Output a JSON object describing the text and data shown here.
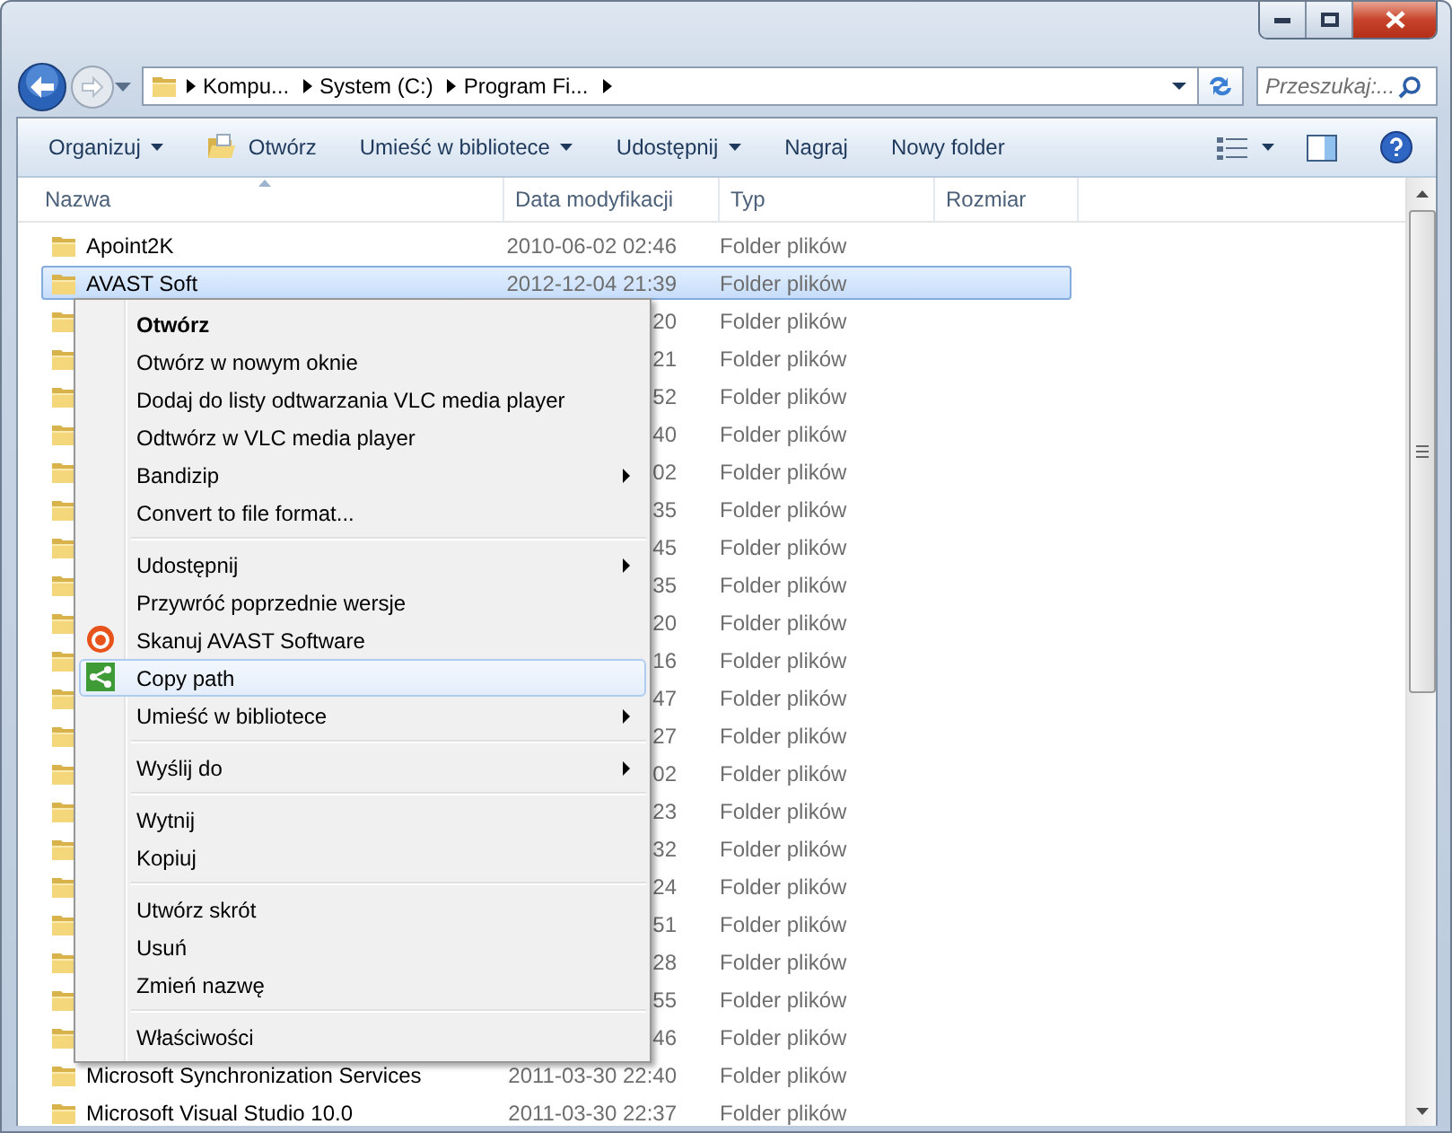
{
  "address": {
    "breadcrumbs": [
      "Kompu...",
      "System (C:)",
      "Program Fi..."
    ]
  },
  "search": {
    "placeholder": "Przeszukaj:..."
  },
  "toolbar": [
    {
      "kind": "plain",
      "label": "Organizuj",
      "dropdown": true
    },
    {
      "kind": "open",
      "label": "Otwórz",
      "dropdown": false
    },
    {
      "kind": "plain",
      "label": "Umieść w bibliotece",
      "dropdown": true
    },
    {
      "kind": "plain",
      "label": "Udostępnij",
      "dropdown": true
    },
    {
      "kind": "plain",
      "label": "Nagraj",
      "dropdown": false
    },
    {
      "kind": "plain",
      "label": "Nowy folder",
      "dropdown": false
    }
  ],
  "columns": [
    "Nazwa",
    "Data modyfikacji",
    "Typ",
    "Rozmiar"
  ],
  "rows": [
    {
      "name": "Apoint2K",
      "date": "2010-06-02 02:46",
      "type": "Folder plików",
      "selected": false
    },
    {
      "name": "AVAST Soft",
      "date": "2012-12-04 21:39",
      "type": "Folder plików",
      "selected": true
    },
    {
      "date": "20",
      "type": "Folder plików",
      "selected": false
    },
    {
      "date": "21",
      "type": "Folder plików",
      "selected": false
    },
    {
      "date": "52",
      "type": "Folder plików",
      "selected": false
    },
    {
      "date": "40",
      "type": "Folder plików",
      "selected": false
    },
    {
      "date": "02",
      "type": "Folder plików",
      "selected": false
    },
    {
      "date": "35",
      "type": "Folder plików",
      "selected": false
    },
    {
      "date": "45",
      "type": "Folder plików",
      "selected": false
    },
    {
      "date": "35",
      "type": "Folder plików",
      "selected": false
    },
    {
      "date": "20",
      "type": "Folder plików",
      "selected": false
    },
    {
      "date": "16",
      "type": "Folder plików",
      "selected": false
    },
    {
      "date": "47",
      "type": "Folder plików",
      "selected": false
    },
    {
      "date": "27",
      "type": "Folder plików",
      "selected": false
    },
    {
      "date": "02",
      "type": "Folder plików",
      "selected": false
    },
    {
      "date": "23",
      "type": "Folder plików",
      "selected": false
    },
    {
      "date": "32",
      "type": "Folder plików",
      "selected": false
    },
    {
      "date": "24",
      "type": "Folder plików",
      "selected": false
    },
    {
      "date": "51",
      "type": "Folder plików",
      "selected": false
    },
    {
      "date": "28",
      "type": "Folder plików",
      "selected": false
    },
    {
      "date": "55",
      "type": "Folder plików",
      "selected": false
    },
    {
      "date": "46",
      "type": "Folder plików",
      "selected": false
    },
    {
      "name": "Microsoft Synchronization Services",
      "date": "2011-03-30 22:40",
      "type": "Folder plików",
      "selected": false
    },
    {
      "name": "Microsoft Visual Studio 10.0",
      "date": "2011-03-30 22:37",
      "type": "Folder plików",
      "selected": false
    }
  ],
  "context_menu": {
    "items": [
      {
        "kind": "item",
        "label": "Otwórz",
        "bold": true,
        "submenu": false,
        "selected": false
      },
      {
        "kind": "item",
        "label": "Otwórz w nowym oknie",
        "bold": false,
        "submenu": false,
        "selected": false
      },
      {
        "kind": "item",
        "label": "Dodaj do listy odtwarzania VLC media player",
        "bold": false,
        "submenu": false,
        "selected": false
      },
      {
        "kind": "item",
        "label": "Odtwórz w VLC media player",
        "bold": false,
        "submenu": false,
        "selected": false
      },
      {
        "kind": "item",
        "label": "Bandizip",
        "bold": false,
        "submenu": true,
        "selected": false
      },
      {
        "kind": "item",
        "label": "Convert to file format...",
        "bold": false,
        "submenu": false,
        "selected": false
      },
      {
        "kind": "separator"
      },
      {
        "kind": "item",
        "label": "Udostępnij",
        "bold": false,
        "submenu": true,
        "selected": false
      },
      {
        "kind": "item",
        "label": "Przywróć poprzednie wersje",
        "bold": false,
        "submenu": false,
        "selected": false
      },
      {
        "kind": "scan",
        "label": "Skanuj AVAST Software",
        "bold": false,
        "submenu": false,
        "selected": false
      },
      {
        "kind": "share",
        "label": "Copy path",
        "bold": false,
        "submenu": false,
        "selected": true
      },
      {
        "kind": "item",
        "label": "Umieść w bibliotece",
        "bold": false,
        "submenu": true,
        "selected": false
      },
      {
        "kind": "separator"
      },
      {
        "kind": "item",
        "label": "Wyślij do",
        "bold": false,
        "submenu": true,
        "selected": false
      },
      {
        "kind": "separator"
      },
      {
        "kind": "item",
        "label": "Wytnij",
        "bold": false,
        "submenu": false,
        "selected": false
      },
      {
        "kind": "item",
        "label": "Kopiuj",
        "bold": false,
        "submenu": false,
        "selected": false
      },
      {
        "kind": "separator"
      },
      {
        "kind": "item",
        "label": "Utwórz skrót",
        "bold": false,
        "submenu": false,
        "selected": false
      },
      {
        "kind": "item",
        "label": "Usuń",
        "bold": false,
        "submenu": false,
        "selected": false
      },
      {
        "kind": "item",
        "label": "Zmień nazwę",
        "bold": false,
        "submenu": false,
        "selected": false
      },
      {
        "kind": "separator"
      },
      {
        "kind": "item",
        "label": "Właściwości",
        "bold": false,
        "submenu": false,
        "selected": false
      }
    ]
  }
}
